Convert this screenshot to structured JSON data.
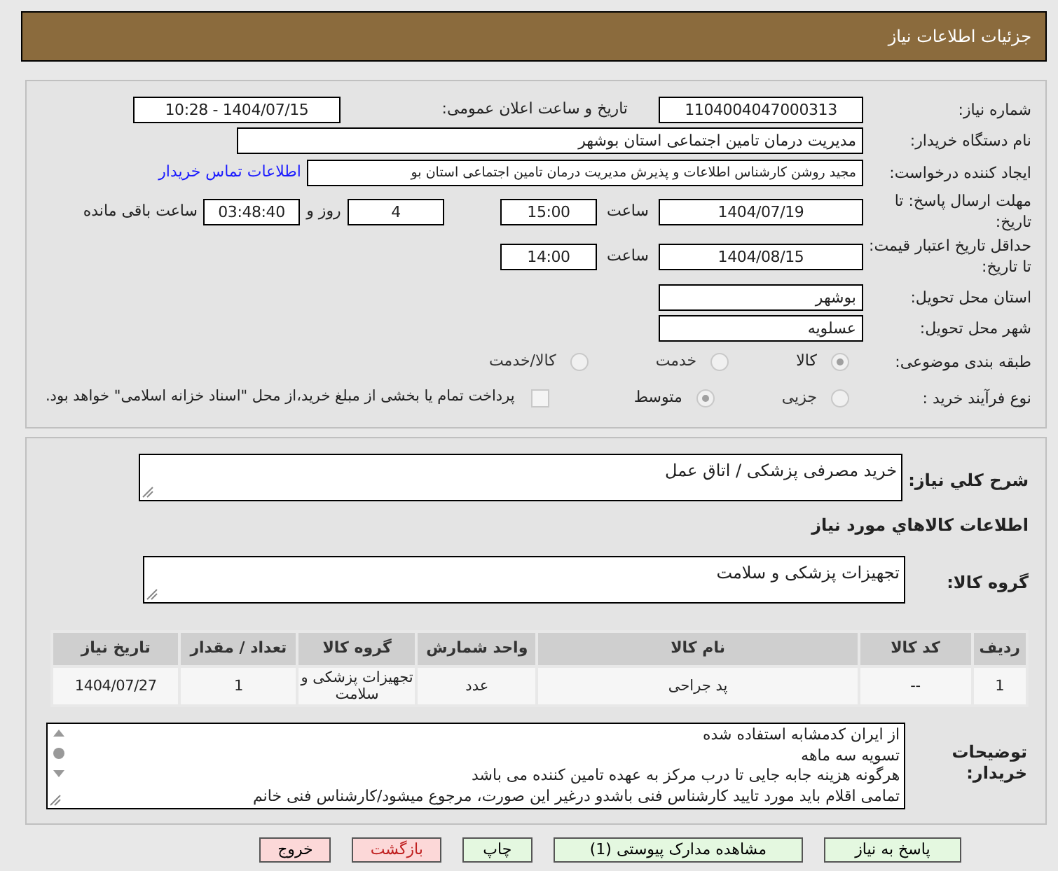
{
  "header": {
    "title": "جزئیات اطلاعات نیاز"
  },
  "need_number": {
    "label": "شماره نیاز:",
    "value": "1104004047000313"
  },
  "announce": {
    "label": "تاریخ و ساعت اعلان عمومی:",
    "value": "1404/07/15 - 10:28"
  },
  "buyer_org": {
    "label": "نام دستگاه خریدار:",
    "value": "مدیریت درمان تامین اجتماعی استان بوشهر"
  },
  "requester": {
    "label": "ایجاد کننده درخواست:",
    "value": "مجید روشن کارشناس اطلاعات و پذیرش مدیریت درمان تامین اجتماعی استان بو",
    "link": "اطلاعات تماس خریدار"
  },
  "deadline": {
    "label": "مهلت ارسال پاسخ: تا تاریخ:",
    "date": "1404/07/19",
    "time_label": "ساعت",
    "time": "15:00",
    "days": "4",
    "days_label": "روز و",
    "remaining": "03:48:40",
    "remaining_label": "ساعت باقی مانده"
  },
  "validity": {
    "label": "حداقل تاریخ اعتبار قیمت: تا تاریخ:",
    "date": "1404/08/15",
    "time_label": "ساعت",
    "time": "14:00"
  },
  "province": {
    "label": "استان محل تحویل:",
    "value": "بوشهر"
  },
  "city": {
    "label": "شهر محل تحویل:",
    "value": "عسلویه"
  },
  "category": {
    "label": "طبقه بندی موضوعی:",
    "options": [
      {
        "label": "کالا",
        "selected": true
      },
      {
        "label": "خدمت",
        "selected": false
      },
      {
        "label": "کالا/خدمت",
        "selected": false
      }
    ]
  },
  "process": {
    "label": "نوع فرآیند خرید :",
    "options": [
      {
        "label": "جزیی",
        "selected": false
      },
      {
        "label": "متوسط",
        "selected": true
      }
    ],
    "payment": {
      "checked": false,
      "label": "پرداخت تمام یا بخشی از مبلغ خرید،از محل \"اسناد خزانه اسلامی\" خواهد بود."
    }
  },
  "description": {
    "label": "شرح کلي نیاز:",
    "value": "خرید مصرفی پزشکی / اتاق عمل"
  },
  "goods_heading": "اطلاعات کالاهاي مورد نیاز",
  "goods_group": {
    "label": "گروه کالا:",
    "value": "تجهیزات پزشکی و سلامت"
  },
  "table": {
    "columns": [
      "ردیف",
      "کد کالا",
      "نام کالا",
      "واحد شمارش",
      "گروه کالا",
      "تعداد / مقدار",
      "تاریخ نیاز"
    ],
    "rows": [
      [
        "1",
        "--",
        "پد جراحی",
        "عدد",
        "تجهیزات پزشکی و سلامت",
        "1",
        "1404/07/27"
      ]
    ]
  },
  "buyer_notes": {
    "label": "توضیحات خریدار:",
    "lines": [
      "از ایران کدمشابه استفاده شده",
      "تسویه سه ماهه",
      "هرگونه هزینه جابه جایی تا درب مرکز به عهده تامین کننده می باشد",
      "تمامی اقلام باید مورد تایید کارشناس فنی باشدو درغیر این صورت، مرجوع میشود/کارشناس فنی خانم"
    ]
  },
  "buttons": [
    {
      "label": "پاسخ به نیاز",
      "kind": "action"
    },
    {
      "label": "مشاهده مدارک پیوستی (1)",
      "kind": "action"
    },
    {
      "label": "چاپ",
      "kind": "action"
    },
    {
      "label": "بازگشت",
      "kind": "back"
    },
    {
      "label": "خروج",
      "kind": "exit"
    }
  ]
}
